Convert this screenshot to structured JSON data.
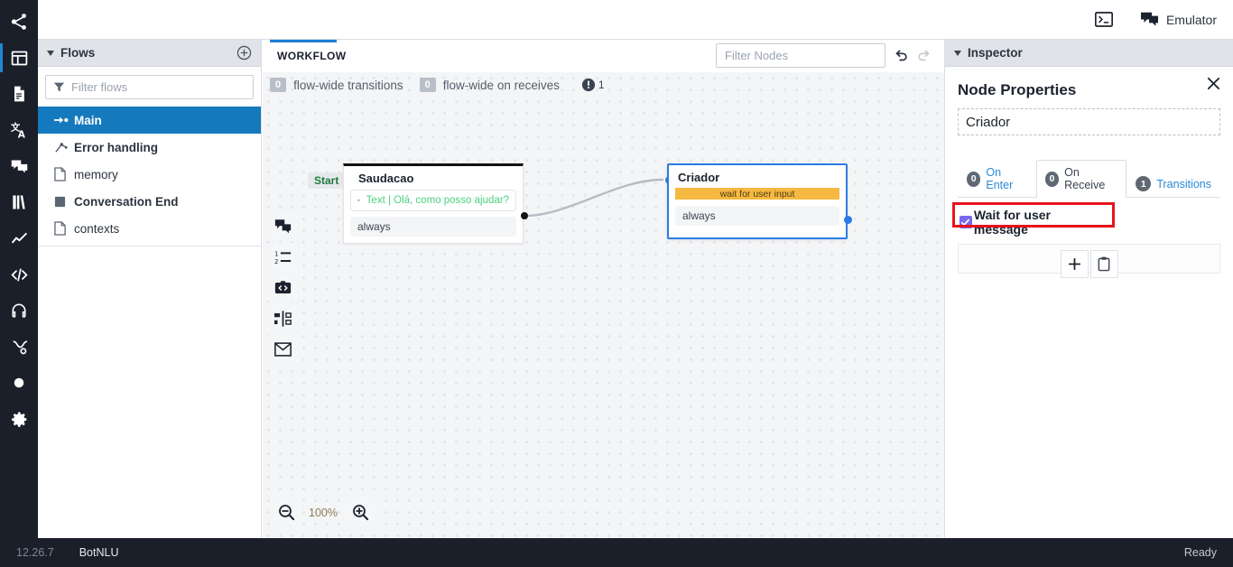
{
  "topbar": {
    "console_icon": "terminal-icon",
    "emulator_icon": "chat-icon",
    "emulator_label": "Emulator"
  },
  "rail": {
    "items": [
      {
        "icon": "share-nodes-icon",
        "selected": false
      },
      {
        "icon": "layout-dashboard-icon",
        "selected": true
      },
      {
        "icon": "document-icon",
        "selected": false
      },
      {
        "icon": "translate-icon",
        "selected": false
      },
      {
        "icon": "chat-bubbles-icon",
        "selected": false
      },
      {
        "icon": "book-icon",
        "selected": false
      },
      {
        "icon": "analytics-chart-icon",
        "selected": false
      },
      {
        "icon": "code-icon",
        "selected": false
      },
      {
        "icon": "headset-icon",
        "selected": false
      },
      {
        "icon": "flow-branch-icon",
        "selected": false
      },
      {
        "icon": "circle-icon",
        "selected": false
      },
      {
        "icon": "gear-icon",
        "selected": false
      }
    ]
  },
  "flows": {
    "header_title": "Flows",
    "add_icon": "plus-circle-icon",
    "caret_icon": "caret-down-icon",
    "filter_icon": "funnel-icon",
    "filter_placeholder": "Filter flows",
    "filter_value": "",
    "items": [
      {
        "label": "Main",
        "icon": "arrow-start-icon",
        "selected": true,
        "bold": true
      },
      {
        "label": "Error handling",
        "icon": "branch-icon",
        "selected": false,
        "bold": true
      },
      {
        "label": "memory",
        "icon": "file-icon",
        "selected": false,
        "bold": false
      },
      {
        "label": "Conversation End",
        "icon": "square-stop-icon",
        "selected": false,
        "bold": true
      },
      {
        "label": "contexts",
        "icon": "file-icon",
        "selected": false,
        "bold": false
      }
    ]
  },
  "workflow": {
    "tab_label": "WORKFLOW",
    "stats": [
      {
        "count": "0",
        "label": "flow-wide transitions"
      },
      {
        "count": "0",
        "label": "flow-wide on receives"
      }
    ],
    "warning_icon": "exclamation-circle-icon",
    "warning_count": "1",
    "filter_nodes_placeholder": "Filter Nodes",
    "filter_nodes_value": "",
    "undo_icon": "undo-arrow-icon",
    "redo_icon": "redo-arrow-icon",
    "node_tools": [
      {
        "icon": "say-something-icon"
      },
      {
        "icon": "numbered-list-icon"
      },
      {
        "icon": "execute-code-icon"
      },
      {
        "icon": "router-split-icon"
      },
      {
        "icon": "email-icon"
      }
    ],
    "zoom": {
      "out_icon": "zoom-out-icon",
      "in_icon": "zoom-in-icon",
      "level": "100%"
    },
    "nodes": [
      {
        "id": "saudacao",
        "title": "Saudacao",
        "start_badge": "Start",
        "content_icon": "chat-bubble-icon",
        "content_text": "Text | Olá, como posso ajudar?",
        "transition": "always",
        "selected": false
      },
      {
        "id": "criador",
        "title": "Criador",
        "wait_bar_text": "wait for user input",
        "transition": "always",
        "selected": true
      }
    ]
  },
  "inspector": {
    "header_title": "Inspector",
    "caret_icon": "caret-down-icon",
    "close_icon": "close-icon",
    "panel_title": "Node Properties",
    "node_name": "Criador",
    "tabs": [
      {
        "badge": "0",
        "label": "On Enter",
        "active": false
      },
      {
        "badge": "0",
        "label": "On Receive",
        "active": true
      },
      {
        "badge": "1",
        "label": "Transitions",
        "active": false
      }
    ],
    "wait_checkbox": {
      "label": "Wait for user message",
      "checked": true,
      "highlight_color": "#e8131b"
    },
    "actions": [
      {
        "icon": "plus-icon"
      },
      {
        "icon": "clipboard-paste-icon"
      }
    ]
  },
  "status": {
    "version": "12.26.7",
    "bot_name": "BotNLU",
    "state": "Ready"
  },
  "colors": {
    "accent_blue": "#1579bd",
    "node_selected": "#2c7be5",
    "wait_bar": "#f5b942",
    "content_green": "#4bd07e",
    "highlight_red": "#e8131b",
    "checkbox_purple": "#7b68ee"
  }
}
